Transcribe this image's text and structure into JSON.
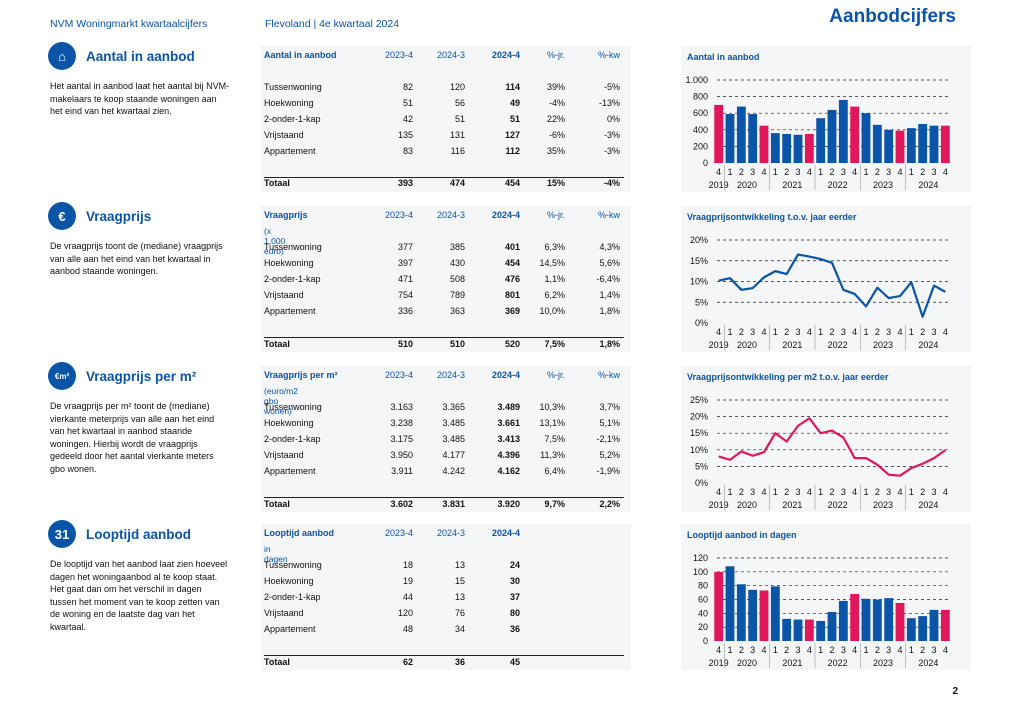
{
  "header": {
    "left": "NVM Woningmarkt kwartaalcijfers",
    "middle": "Flevoland | 4e kwartaal 2024",
    "title": "Aanbodcijfers"
  },
  "page_number": "2",
  "colors": {
    "blue": "#0a55a8",
    "pink": "#e0185b",
    "panel": "#f5f6f8"
  },
  "sections": [
    {
      "icon": "house-hand-icon",
      "title": "Aantal in aanbod",
      "desc": "Het aantal in aanbod laat het aantal bij NVM-makelaars te koop staande woningen aan het eind van het kwartaal zien.",
      "table": {
        "header": [
          "Aantal in aanbod",
          "2023-4",
          "2024-3",
          "2024-4",
          "%-jr.",
          "%-kw"
        ],
        "subheader": "",
        "rows": [
          [
            "Tussenwoning",
            "82",
            "120",
            "114",
            "39%",
            "-5%"
          ],
          [
            "Hoekwoning",
            "51",
            "56",
            "49",
            "-4%",
            "-13%"
          ],
          [
            "2-onder-1-kap",
            "42",
            "51",
            "51",
            "22%",
            "0%"
          ],
          [
            "Vrijstaand",
            "135",
            "131",
            "127",
            "-6%",
            "-3%"
          ],
          [
            "Appartement",
            "83",
            "116",
            "112",
            "35%",
            "-3%"
          ]
        ],
        "total": [
          "Totaal",
          "393",
          "474",
          "454",
          "15%",
          "-4%"
        ]
      },
      "chart_title": "Aantal in aanbod"
    },
    {
      "icon": "euro-icon",
      "title": "Vraagprijs",
      "desc": "De vraagprijs toont de (mediane) vraagprijs van alle aan het eind van het kwartaal in aanbod staande woningen.",
      "table": {
        "header": [
          "Vraagprijs",
          "2023-4",
          "2024-3",
          "2024-4",
          "%-jr.",
          "%-kw"
        ],
        "subheader": "(x 1.000 euro)",
        "rows": [
          [
            "Tussenwoning",
            "377",
            "385",
            "401",
            "6,3%",
            "4,3%"
          ],
          [
            "Hoekwoning",
            "397",
            "430",
            "454",
            "14,5%",
            "5,6%"
          ],
          [
            "2-onder-1-kap",
            "471",
            "508",
            "476",
            "1,1%",
            "-6,4%"
          ],
          [
            "Vrijstaand",
            "754",
            "789",
            "801",
            "6,2%",
            "1,4%"
          ],
          [
            "Appartement",
            "336",
            "363",
            "369",
            "10,0%",
            "1,8%"
          ]
        ],
        "total": [
          "Totaal",
          "510",
          "510",
          "520",
          "7,5%",
          "1,8%"
        ]
      },
      "chart_title": "Vraagprijsontwikkeling t.o.v. jaar eerder"
    },
    {
      "icon": "euro-m2-icon",
      "title": "Vraagprijs per m²",
      "desc": "De vraagprijs per m² toont de (mediane) vierkante meterprijs van alle aan het eind van het kwartaal in aanbod staande woningen. Hierbij wordt de vraagprijs gedeeld door het aantal vierkante meters gbo wonen.",
      "table": {
        "header": [
          "Vraagprijs per m²",
          "2023-4",
          "2024-3",
          "2024-4",
          "%-jr.",
          "%-kw"
        ],
        "subheader": "(euro/m2 gbo wonen)",
        "rows": [
          [
            "Tussenwoning",
            "3.163",
            "3.365",
            "3.489",
            "10,3%",
            "3,7%"
          ],
          [
            "Hoekwoning",
            "3.238",
            "3.485",
            "3.661",
            "13,1%",
            "5,1%"
          ],
          [
            "2-onder-1-kap",
            "3.175",
            "3.485",
            "3.413",
            "7,5%",
            "-2,1%"
          ],
          [
            "Vrijstaand",
            "3.950",
            "4.177",
            "4.396",
            "11,3%",
            "5,2%"
          ],
          [
            "Appartement",
            "3.911",
            "4.242",
            "4.162",
            "6,4%",
            "-1,9%"
          ]
        ],
        "total": [
          "Totaal",
          "3.602",
          "3.831",
          "3.920",
          "9,7%",
          "2,2%"
        ]
      },
      "chart_title": "Vraagprijsontwikkeling per m2 t.o.v. jaar eerder"
    },
    {
      "icon": "calendar-icon",
      "title": "Looptijd aanbod",
      "desc": "De looptijd van het aanbod laat zien hoeveel dagen het woningaanbod al te koop staat. Het gaat dan om het verschil in dagen tussen het moment van te koop zetten van de woning en de laatste dag van het kwartaal.",
      "table": {
        "header": [
          "Looptijd aanbod",
          "2023-4",
          "2024-3",
          "2024-4",
          "",
          ""
        ],
        "subheader": "in dagen",
        "rows": [
          [
            "Tussenwoning",
            "18",
            "13",
            "24",
            "",
            ""
          ],
          [
            "Hoekwoning",
            "19",
            "15",
            "30",
            "",
            ""
          ],
          [
            "2-onder-1-kap",
            "44",
            "13",
            "37",
            "",
            ""
          ],
          [
            "Vrijstaand",
            "120",
            "76",
            "80",
            "",
            ""
          ],
          [
            "Appartement",
            "48",
            "34",
            "36",
            "",
            ""
          ]
        ],
        "total": [
          "Totaal",
          "62",
          "36",
          "45",
          "",
          ""
        ]
      },
      "chart_title": "Looptijd aanbod in dagen"
    }
  ],
  "chart_data": [
    {
      "type": "bar",
      "title": "Aantal in aanbod",
      "quarters": [
        "4",
        "1",
        "2",
        "3",
        "4",
        "1",
        "2",
        "3",
        "4",
        "1",
        "2",
        "3",
        "4",
        "1",
        "2",
        "3",
        "4",
        "1",
        "2",
        "3",
        "4"
      ],
      "years": [
        "2019",
        "2020",
        "2021",
        "2022",
        "2023",
        "2024"
      ],
      "values": [
        700,
        590,
        680,
        590,
        450,
        360,
        350,
        340,
        350,
        540,
        640,
        760,
        680,
        600,
        460,
        400,
        390,
        420,
        470,
        450,
        450
      ],
      "highlight": [
        0,
        4,
        8,
        12,
        16,
        20
      ],
      "yticks": [
        "1.000",
        "800",
        "600",
        "400",
        "200",
        "0"
      ],
      "ylim": [
        0,
        1000
      ]
    },
    {
      "type": "line",
      "title": "Vraagprijsontwikkeling t.o.v. jaar eerder",
      "quarters": [
        "4",
        "1",
        "2",
        "3",
        "4",
        "1",
        "2",
        "3",
        "4",
        "1",
        "2",
        "3",
        "4",
        "1",
        "2",
        "3",
        "4",
        "1",
        "2",
        "3",
        "4"
      ],
      "years": [
        "2019",
        "2020",
        "2021",
        "2022",
        "2023",
        "2024"
      ],
      "values": [
        10.2,
        10.8,
        8.0,
        8.4,
        11.0,
        12.5,
        11.8,
        16.5,
        16.0,
        15.4,
        14.5,
        8.0,
        7.0,
        4.0,
        8.5,
        6.0,
        6.5,
        9.8,
        1.5,
        9.0,
        7.5
      ],
      "yticks": [
        "20%",
        "15%",
        "10%",
        "5%",
        "0%"
      ],
      "ylim": [
        0,
        20
      ],
      "color": "#0a55a8"
    },
    {
      "type": "line",
      "title": "Vraagprijsontwikkeling per m2 t.o.v. jaar eerder",
      "quarters": [
        "4",
        "1",
        "2",
        "3",
        "4",
        "1",
        "2",
        "3",
        "4",
        "1",
        "2",
        "3",
        "4",
        "1",
        "2",
        "3",
        "4",
        "1",
        "2",
        "3",
        "4"
      ],
      "years": [
        "2019",
        "2020",
        "2021",
        "2022",
        "2023",
        "2024"
      ],
      "values": [
        8.0,
        7.0,
        9.5,
        8.2,
        9.3,
        15.0,
        12.5,
        17.2,
        19.5,
        15.0,
        15.8,
        13.7,
        7.5,
        7.5,
        5.5,
        2.5,
        2.2,
        4.5,
        5.8,
        7.5,
        9.9
      ],
      "yticks": [
        "25%",
        "20%",
        "15%",
        "10%",
        "5%",
        "0%"
      ],
      "ylim": [
        0,
        25
      ],
      "color": "#e0185b"
    },
    {
      "type": "bar",
      "title": "Looptijd aanbod in dagen",
      "quarters": [
        "4",
        "1",
        "2",
        "3",
        "4",
        "1",
        "2",
        "3",
        "4",
        "1",
        "2",
        "3",
        "4",
        "1",
        "2",
        "3",
        "4",
        "1",
        "2",
        "3",
        "4"
      ],
      "years": [
        "2019",
        "2020",
        "2021",
        "2022",
        "2023",
        "2024"
      ],
      "values": [
        100,
        108,
        82,
        74,
        73,
        79,
        32,
        31,
        31,
        29,
        42,
        58,
        68,
        61,
        60,
        62,
        55,
        33,
        36,
        45,
        45
      ],
      "highlight": [
        0,
        4,
        8,
        12,
        16,
        20
      ],
      "yticks": [
        "120",
        "100",
        "80",
        "60",
        "40",
        "20",
        "0"
      ],
      "ylim": [
        0,
        120
      ]
    }
  ]
}
